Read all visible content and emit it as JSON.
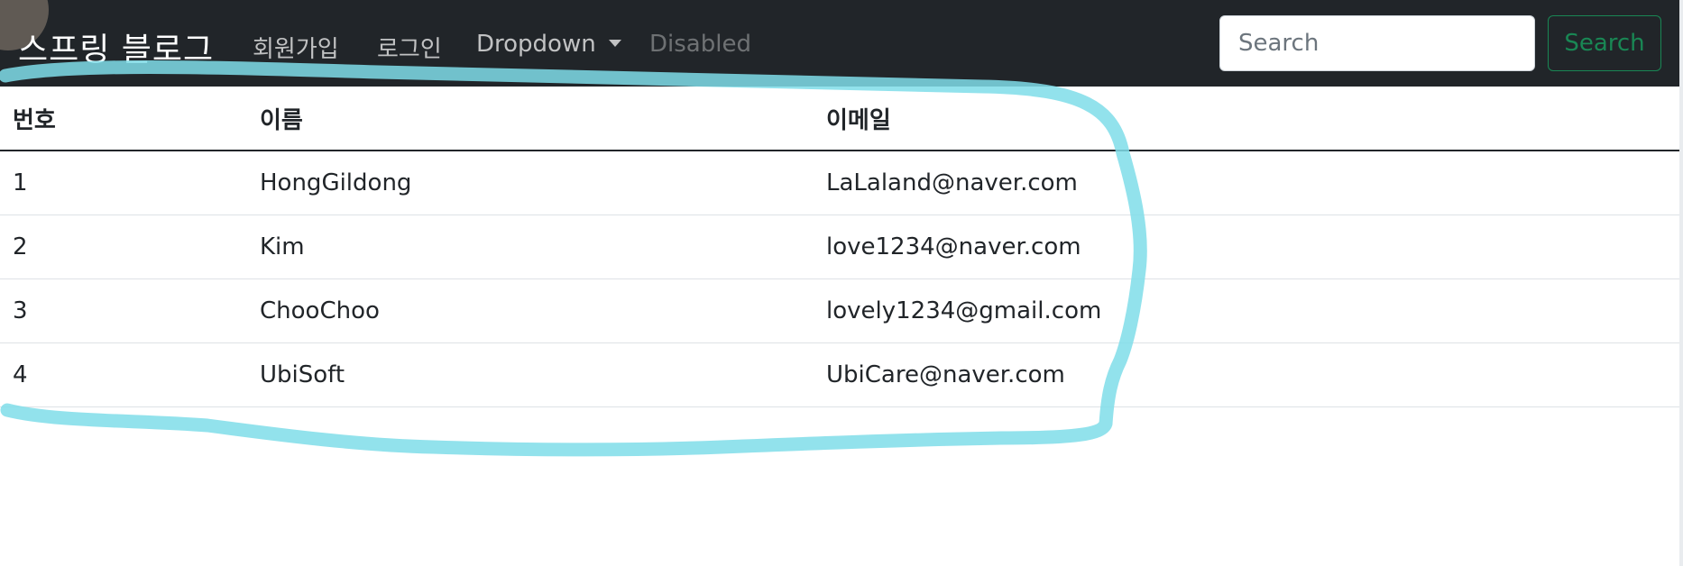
{
  "navbar": {
    "brand": "스프링 블로그",
    "links": [
      {
        "label": "회원가입"
      },
      {
        "label": "로그인"
      },
      {
        "label": "Dropdown"
      },
      {
        "label": "Disabled"
      }
    ],
    "search": {
      "placeholder": "Search",
      "value": "",
      "button_label": "Search"
    }
  },
  "table": {
    "headers": [
      "번호",
      "이름",
      "이메일"
    ],
    "rows": [
      {
        "id": "1",
        "name": "HongGildong",
        "email": "LaLaland@naver.com"
      },
      {
        "id": "2",
        "name": "Kim",
        "email": "love1234@naver.com"
      },
      {
        "id": "3",
        "name": "ChooChoo",
        "email": "lovely1234@gmail.com"
      },
      {
        "id": "4",
        "name": "UbiSoft",
        "email": "UbiCare@naver.com"
      }
    ]
  },
  "colors": {
    "navbar_bg": "#212529",
    "success": "#198754",
    "highlighter": "#7fdde9"
  }
}
